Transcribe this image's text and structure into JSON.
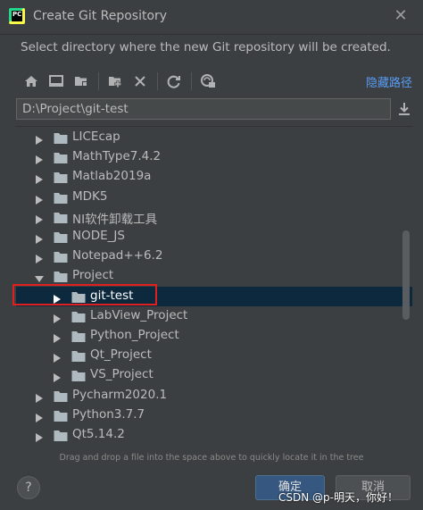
{
  "window": {
    "title": "Create Git Repository",
    "app_icon_text": "PC"
  },
  "subtitle": "Select directory where the new Git repository will be created.",
  "toolbar": {
    "hide_path_label": "隐藏路径"
  },
  "path": {
    "value": "D:\\Project\\git-test"
  },
  "tree": {
    "items": [
      {
        "label": "LICEcap",
        "level": 0,
        "expanded": false
      },
      {
        "label": "MathType7.4.2",
        "level": 0,
        "expanded": false
      },
      {
        "label": "Matlab2019a",
        "level": 0,
        "expanded": false
      },
      {
        "label": "MDK5",
        "level": 0,
        "expanded": false
      },
      {
        "label": "NI软件卸载工具",
        "level": 0,
        "expanded": false
      },
      {
        "label": "NODE_JS",
        "level": 0,
        "expanded": false
      },
      {
        "label": "Notepad++6.2",
        "level": 0,
        "expanded": false
      },
      {
        "label": "Project",
        "level": 0,
        "expanded": true
      },
      {
        "label": "git-test",
        "level": 1,
        "expanded": false,
        "selected": true
      },
      {
        "label": "LabView_Project",
        "level": 1,
        "expanded": false
      },
      {
        "label": "Python_Project",
        "level": 1,
        "expanded": false
      },
      {
        "label": "Qt_Project",
        "level": 1,
        "expanded": false
      },
      {
        "label": "VS_Project",
        "level": 1,
        "expanded": false
      },
      {
        "label": "Pycharm2020.1",
        "level": 0,
        "expanded": false
      },
      {
        "label": "Python3.7.7",
        "level": 0,
        "expanded": false
      },
      {
        "label": "Qt5.14.2",
        "level": 0,
        "expanded": false
      }
    ]
  },
  "hint": "Drag and drop a file into the space above to quickly locate it in the tree",
  "buttons": {
    "help": "?",
    "ok": "确定",
    "cancel": "取消"
  },
  "watermark": "CSDN @p-明天，你好！",
  "colors": {
    "background": "#3c3f41",
    "selection": "#0d293e",
    "link": "#589df6",
    "highlight_box": "#e02020",
    "ok_button": "#365880"
  }
}
